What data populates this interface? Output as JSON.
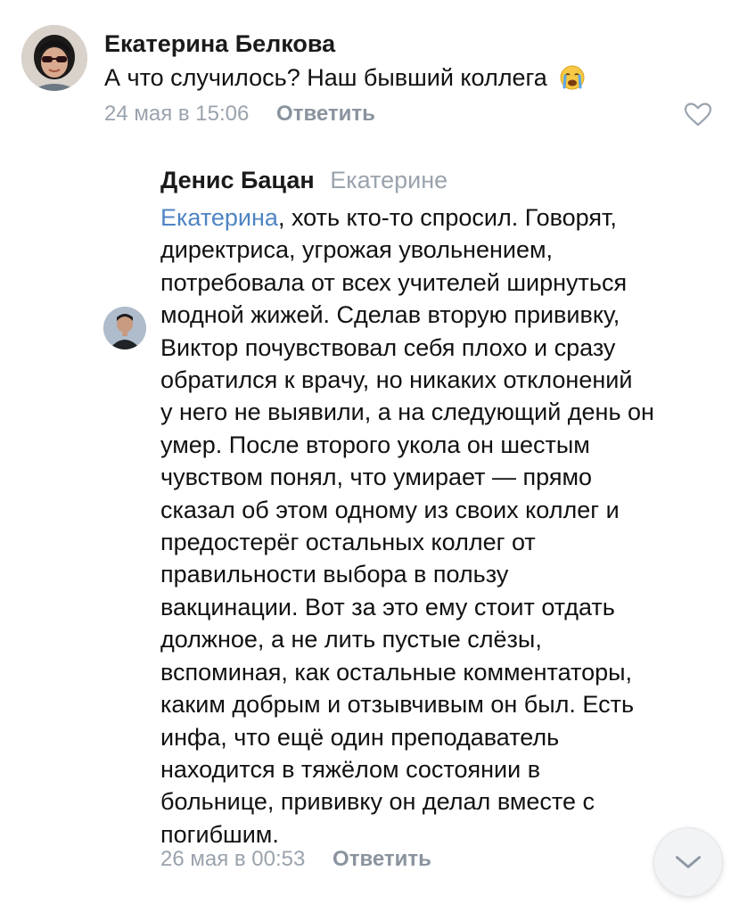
{
  "comments": [
    {
      "author": "Екатерина Белкова",
      "text": "А что случилось? Наш бывший коллега",
      "emoji": "crying-face",
      "time": "24 мая в 15:06",
      "reply_label": "Ответить",
      "like_icon": "heart-outline-icon"
    },
    {
      "author": "Денис Бацан",
      "reply_to": "Екатерине",
      "mention": "Екатерина",
      "lines": [
        ", хоть кто-то спросил. Говорят,",
        "директриса, угрожая увольнением,",
        "потребовала от всех учителей ширнуться",
        "модной жижей. Сделав вторую прививку,",
        "Виктор почувствовал себя плохо и сразу",
        "обратился к врачу, но никаких отклонений",
        "у него не выявили, а на следующий день он",
        "умер. После второго укола он шестым",
        "чувством понял, что умирает — прямо",
        "сказал об этом одному из своих коллег и",
        "предостерёг остальных коллег от",
        "правильности выбора в пользу",
        "вакцинации. Вот за это ему стоит отдать",
        "должное, а не лить пустые слёзы,",
        "вспоминая, как остальные комментаторы,",
        "каким добрым и отзывчивым он был. Есть",
        "инфа, что ещё один преподаватель",
        "находится в тяжёлом состоянии в",
        "больнице, прививку он делал вместе с",
        "погибшим."
      ],
      "time": "26 мая в 00:53",
      "reply_label": "Ответить"
    }
  ],
  "scroll_button_icon": "chevron-down-icon",
  "colors": {
    "text": "#111111",
    "meta": "#9aa3ad",
    "link": "#4f84c4",
    "reply": "#8a949f"
  }
}
